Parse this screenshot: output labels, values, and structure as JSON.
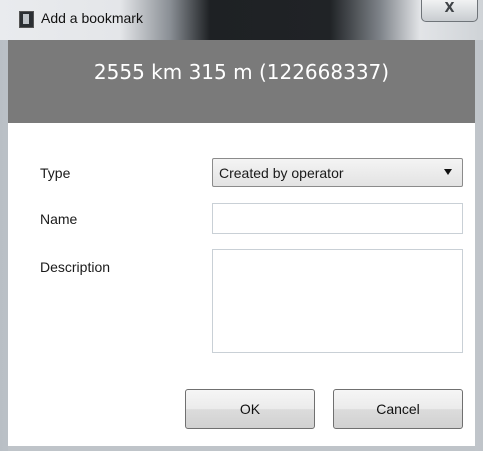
{
  "window": {
    "title": "Add a bookmark",
    "close_symbol": "X",
    "icon": "bookmark-icon"
  },
  "header": {
    "position_text": "2555 km 315 m (122668337)"
  },
  "form": {
    "type_label": "Type",
    "type_value": "Created by operator",
    "name_label": "Name",
    "name_value": "",
    "description_label": "Description",
    "description_value": ""
  },
  "buttons": {
    "ok_label": "OK",
    "cancel_label": "Cancel"
  }
}
